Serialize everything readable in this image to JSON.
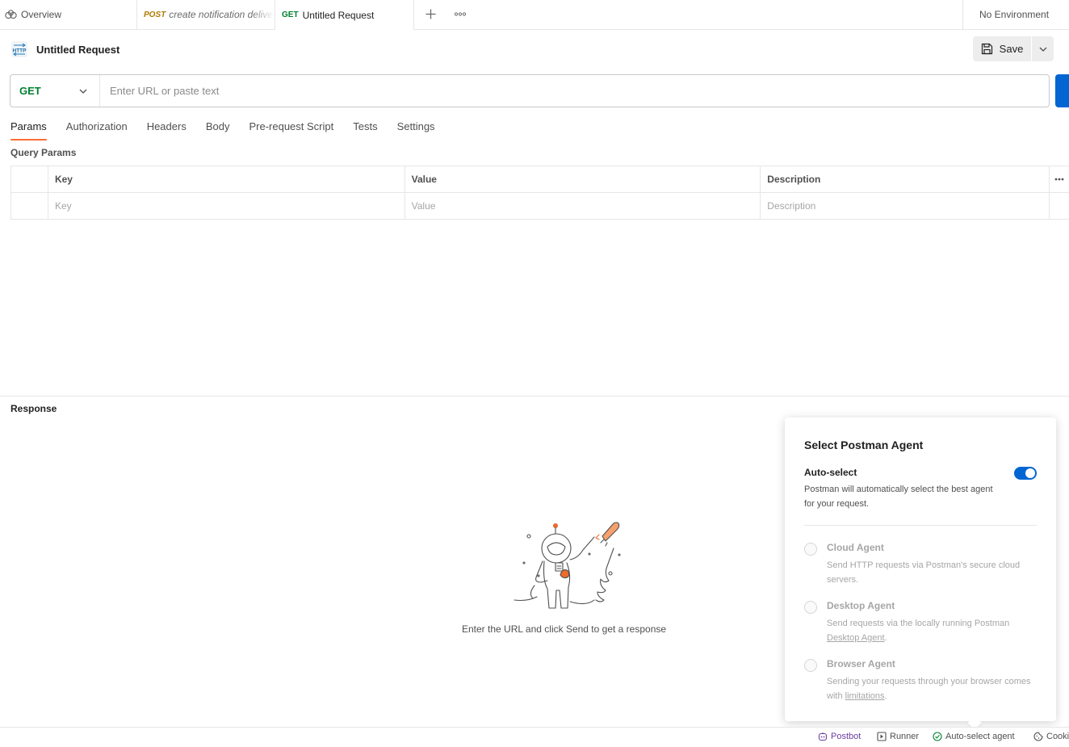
{
  "tabs": {
    "overview_label": "Overview",
    "post_method": "POST",
    "post_label": "create notification delivery",
    "active_method": "GET",
    "active_label": "Untitled Request",
    "environment": "No Environment"
  },
  "request": {
    "title": "Untitled Request",
    "save_label": "Save",
    "method": "GET",
    "url_value": "",
    "url_placeholder": "Enter URL or paste text"
  },
  "request_tabs": [
    "Params",
    "Authorization",
    "Headers",
    "Body",
    "Pre-request Script",
    "Tests",
    "Settings"
  ],
  "active_request_tab": "Params",
  "params": {
    "section_label": "Query Params",
    "headers": [
      "Key",
      "Value",
      "Description"
    ],
    "placeholders": [
      "Key",
      "Value",
      "Description"
    ]
  },
  "response": {
    "label": "Response",
    "empty_text": "Enter the URL and click Send to get a response"
  },
  "agent_popover": {
    "title": "Select Postman Agent",
    "auto_title": "Auto-select",
    "auto_desc": "Postman will automatically select the best agent for your request.",
    "auto_enabled": true,
    "cloud_title": "Cloud Agent",
    "cloud_desc": "Send HTTP requests via Postman's secure cloud servers.",
    "desktop_title": "Desktop Agent",
    "desktop_desc_1": "Send requests via the locally running Postman ",
    "desktop_link": "Desktop Agent",
    "desktop_desc_2": ".",
    "browser_title": "Browser Agent",
    "browser_desc_1": "Sending your requests through your browser comes with ",
    "browser_link": "limitations",
    "browser_desc_2": "."
  },
  "statusbar": {
    "postbot": "Postbot",
    "runner": "Runner",
    "agent": "Auto-select agent",
    "cookies": "Cookies"
  },
  "colors": {
    "accent_orange": "#ff6c37",
    "primary_blue": "#0265d2",
    "get_green": "#007f31",
    "post_amber": "#ad7a03",
    "postbot_purple": "#6a3ea1"
  }
}
